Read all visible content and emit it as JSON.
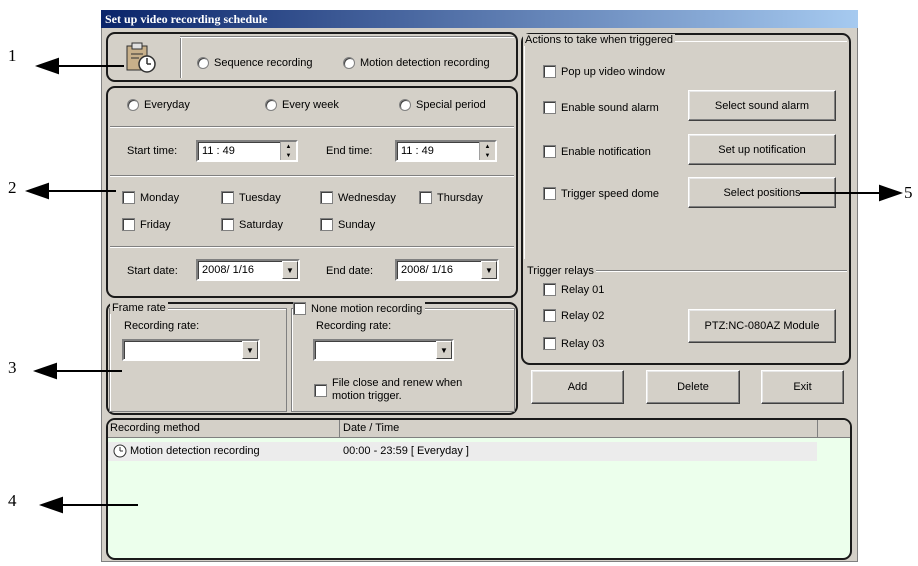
{
  "window": {
    "title": "Set up video recording schedule"
  },
  "callouts": [
    "1",
    "2",
    "3",
    "4",
    "5"
  ],
  "schedule_type": {
    "sequence_label": "Sequence recording",
    "motion_label": "Motion detection recording"
  },
  "period": {
    "everyday_label": "Everyday",
    "every_week_label": "Every week",
    "special_period_label": "Special period",
    "start_time_label": "Start time:",
    "start_time_value": "11  :  49",
    "end_time_label": "End time:",
    "end_time_value": "11  :  49",
    "days": [
      "Monday",
      "Tuesday",
      "Wednesday",
      "Thursday",
      "Friday",
      "Saturday",
      "Sunday"
    ],
    "start_date_label": "Start date:",
    "start_date_value": "2008/ 1/16",
    "end_date_label": "End date:",
    "end_date_value": "2008/ 1/16"
  },
  "frame_rate": {
    "legend": "Frame rate",
    "recording_rate_label": "Recording rate:",
    "recording_rate_value": ""
  },
  "none_motion": {
    "legend": "None motion recording",
    "recording_rate_label": "Recording rate:",
    "recording_rate_value": "",
    "file_close_label_1": "File close and renew when",
    "file_close_label_2": "motion trigger."
  },
  "actions": {
    "legend": "Actions to take when triggered",
    "popup_label": "Pop up video window",
    "sound_label": "Enable sound alarm",
    "select_sound_button": "Select sound alarm",
    "notification_label": "Enable notification",
    "setup_notification_button": "Set up notification",
    "speed_dome_label": "Trigger speed dome",
    "select_positions_button": "Select positions"
  },
  "relays": {
    "legend": "Trigger relays",
    "items": [
      "Relay 01",
      "Relay 02",
      "Relay 03"
    ],
    "module_button": "PTZ:NC-080AZ Module"
  },
  "buttons": {
    "add": "Add",
    "delete": "Delete",
    "exit": "Exit"
  },
  "table": {
    "columns": [
      "Recording method",
      "Date / Time"
    ],
    "rows": [
      {
        "method": "Motion detection recording",
        "datetime": "00:00 - 23:59 [ Everyday ]"
      }
    ]
  }
}
